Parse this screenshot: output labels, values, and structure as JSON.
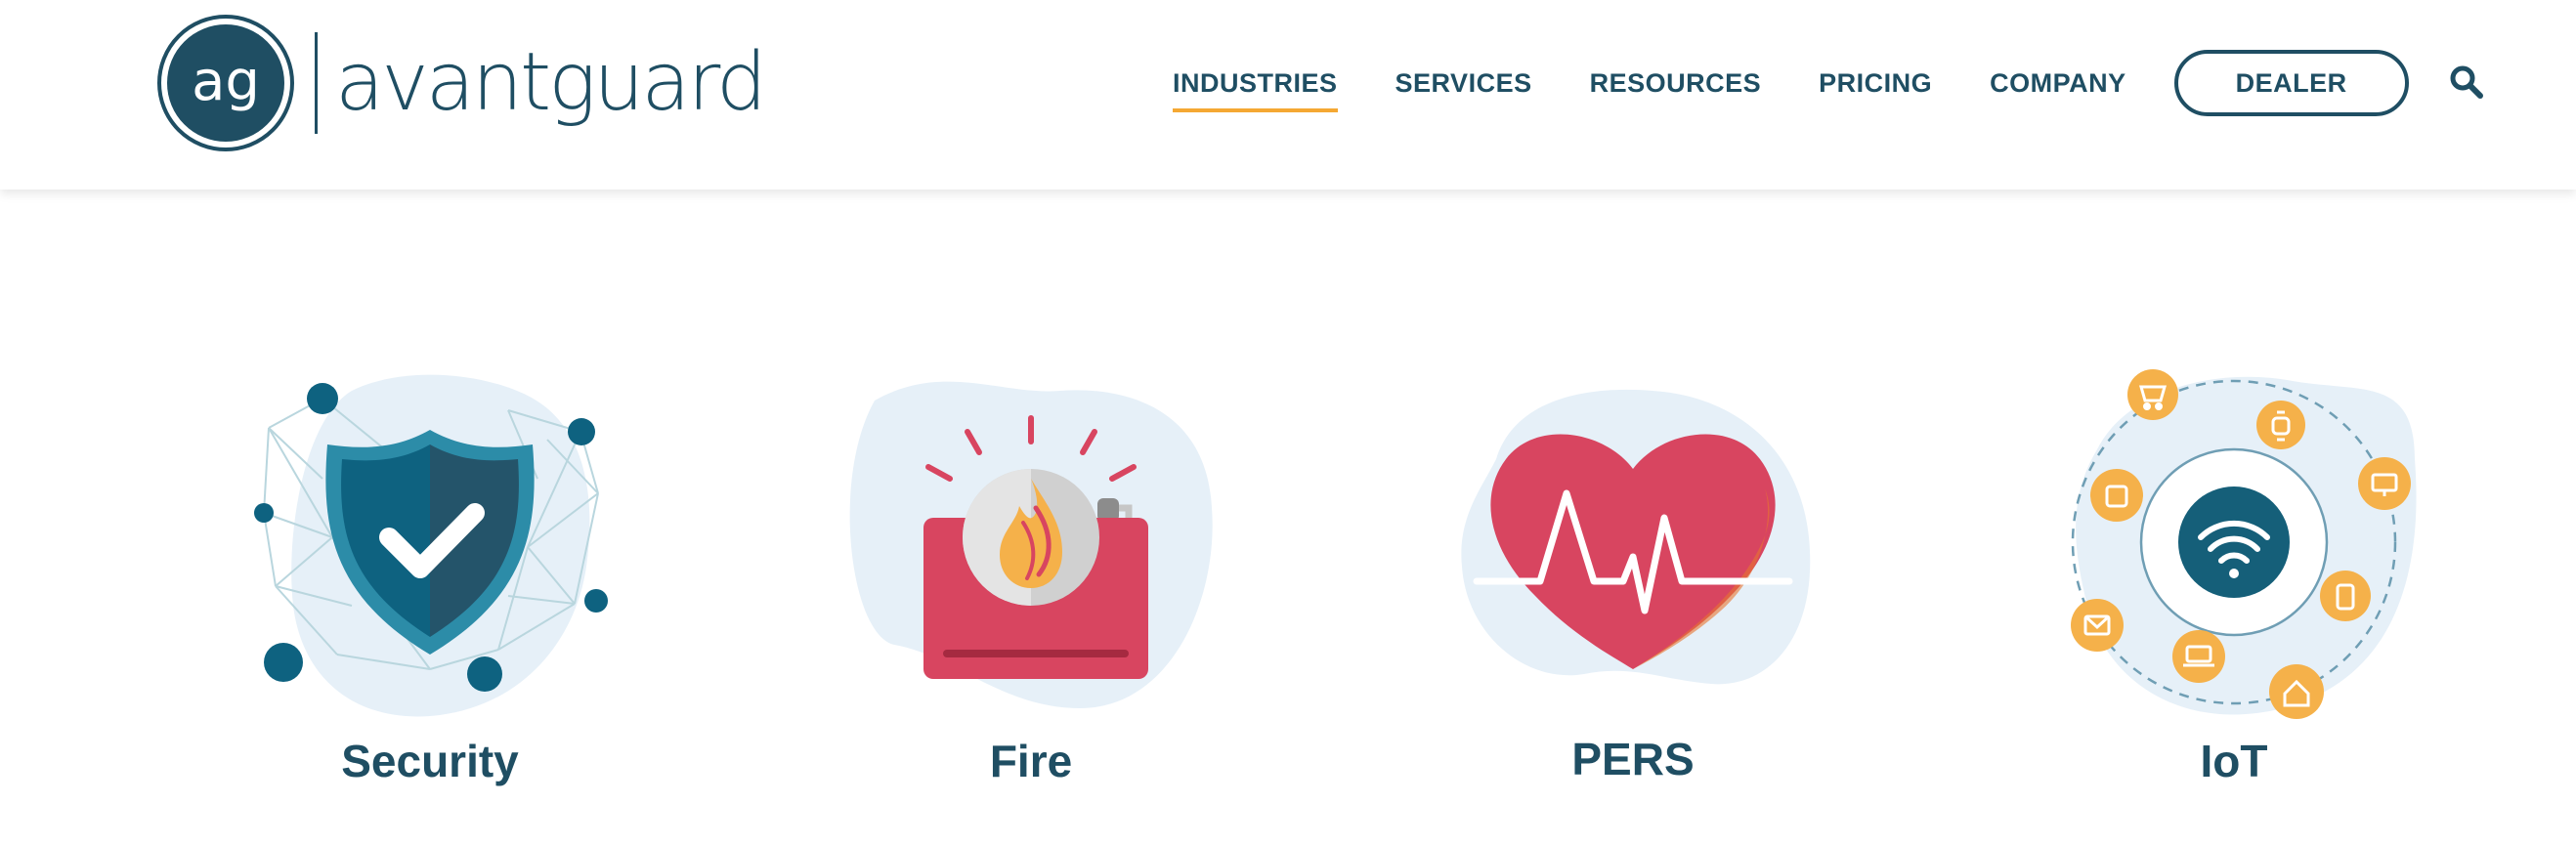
{
  "brand": {
    "logo_monogram": "ag",
    "logo_text": "avantguard",
    "color_primary": "#1f4e63",
    "color_accent": "#f5a833"
  },
  "nav": {
    "items": [
      {
        "label": "INDUSTRIES",
        "active": true
      },
      {
        "label": "SERVICES",
        "active": false
      },
      {
        "label": "RESOURCES",
        "active": false
      },
      {
        "label": "PRICING",
        "active": false
      },
      {
        "label": "COMPANY",
        "active": false
      }
    ],
    "dealer_label": "DEALER",
    "search_icon": "search-icon"
  },
  "industries": [
    {
      "label": "Security",
      "icon": "shield-check-icon"
    },
    {
      "label": "Fire",
      "icon": "fire-alarm-icon"
    },
    {
      "label": "PERS",
      "icon": "heartbeat-icon"
    },
    {
      "label": "IoT",
      "icon": "wifi-network-icon"
    }
  ]
}
